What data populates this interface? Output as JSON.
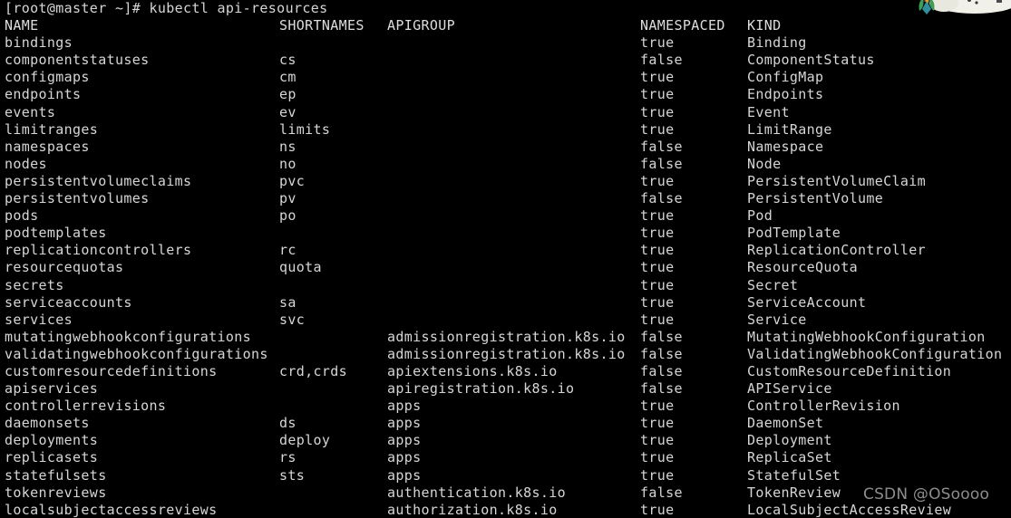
{
  "terminal": {
    "prompt_line": "[root@master ~]# kubectl api-resources",
    "prompt": "[root@master ~]#",
    "command": "kubectl api-resources",
    "foreground_color": "#d6d6d6",
    "background_color": "#000000",
    "columns": {
      "name": "NAME",
      "shortnames": "SHORTNAMES",
      "apigroup": "APIGROUP",
      "namespaced": "NAMESPACED",
      "kind": "KIND"
    },
    "rows": [
      {
        "name": "bindings",
        "shortnames": "",
        "apigroup": "",
        "namespaced": "true",
        "kind": "Binding"
      },
      {
        "name": "componentstatuses",
        "shortnames": "cs",
        "apigroup": "",
        "namespaced": "false",
        "kind": "ComponentStatus"
      },
      {
        "name": "configmaps",
        "shortnames": "cm",
        "apigroup": "",
        "namespaced": "true",
        "kind": "ConfigMap"
      },
      {
        "name": "endpoints",
        "shortnames": "ep",
        "apigroup": "",
        "namespaced": "true",
        "kind": "Endpoints"
      },
      {
        "name": "events",
        "shortnames": "ev",
        "apigroup": "",
        "namespaced": "true",
        "kind": "Event"
      },
      {
        "name": "limitranges",
        "shortnames": "limits",
        "apigroup": "",
        "namespaced": "true",
        "kind": "LimitRange"
      },
      {
        "name": "namespaces",
        "shortnames": "ns",
        "apigroup": "",
        "namespaced": "false",
        "kind": "Namespace"
      },
      {
        "name": "nodes",
        "shortnames": "no",
        "apigroup": "",
        "namespaced": "false",
        "kind": "Node"
      },
      {
        "name": "persistentvolumeclaims",
        "shortnames": "pvc",
        "apigroup": "",
        "namespaced": "true",
        "kind": "PersistentVolumeClaim"
      },
      {
        "name": "persistentvolumes",
        "shortnames": "pv",
        "apigroup": "",
        "namespaced": "false",
        "kind": "PersistentVolume"
      },
      {
        "name": "pods",
        "shortnames": "po",
        "apigroup": "",
        "namespaced": "true",
        "kind": "Pod"
      },
      {
        "name": "podtemplates",
        "shortnames": "",
        "apigroup": "",
        "namespaced": "true",
        "kind": "PodTemplate"
      },
      {
        "name": "replicationcontrollers",
        "shortnames": "rc",
        "apigroup": "",
        "namespaced": "true",
        "kind": "ReplicationController"
      },
      {
        "name": "resourcequotas",
        "shortnames": "quota",
        "apigroup": "",
        "namespaced": "true",
        "kind": "ResourceQuota"
      },
      {
        "name": "secrets",
        "shortnames": "",
        "apigroup": "",
        "namespaced": "true",
        "kind": "Secret"
      },
      {
        "name": "serviceaccounts",
        "shortnames": "sa",
        "apigroup": "",
        "namespaced": "true",
        "kind": "ServiceAccount"
      },
      {
        "name": "services",
        "shortnames": "svc",
        "apigroup": "",
        "namespaced": "true",
        "kind": "Service"
      },
      {
        "name": "mutatingwebhookconfigurations",
        "shortnames": "",
        "apigroup": "admissionregistration.k8s.io",
        "namespaced": "false",
        "kind": "MutatingWebhookConfiguration"
      },
      {
        "name": "validatingwebhookconfigurations",
        "shortnames": "",
        "apigroup": "admissionregistration.k8s.io",
        "namespaced": "false",
        "kind": "ValidatingWebhookConfiguration"
      },
      {
        "name": "customresourcedefinitions",
        "shortnames": "crd,crds",
        "apigroup": "apiextensions.k8s.io",
        "namespaced": "false",
        "kind": "CustomResourceDefinition"
      },
      {
        "name": "apiservices",
        "shortnames": "",
        "apigroup": "apiregistration.k8s.io",
        "namespaced": "false",
        "kind": "APIService"
      },
      {
        "name": "controllerrevisions",
        "shortnames": "",
        "apigroup": "apps",
        "namespaced": "true",
        "kind": "ControllerRevision"
      },
      {
        "name": "daemonsets",
        "shortnames": "ds",
        "apigroup": "apps",
        "namespaced": "true",
        "kind": "DaemonSet"
      },
      {
        "name": "deployments",
        "shortnames": "deploy",
        "apigroup": "apps",
        "namespaced": "true",
        "kind": "Deployment"
      },
      {
        "name": "replicasets",
        "shortnames": "rs",
        "apigroup": "apps",
        "namespaced": "true",
        "kind": "ReplicaSet"
      },
      {
        "name": "statefulsets",
        "shortnames": "sts",
        "apigroup": "apps",
        "namespaced": "true",
        "kind": "StatefulSet"
      },
      {
        "name": "tokenreviews",
        "shortnames": "",
        "apigroup": "authentication.k8s.io",
        "namespaced": "false",
        "kind": "TokenReview"
      },
      {
        "name": "localsubjectaccessreviews",
        "shortnames": "",
        "apigroup": "authorization.k8s.io",
        "namespaced": "true",
        "kind": "LocalSubjectAccessReview"
      }
    ]
  },
  "watermark": {
    "text": "CSDN @OSoooo",
    "color": "#8d8d8d"
  },
  "corner_sticker": {
    "label": "cartoon-sticker",
    "colors": {
      "cloud": "#f2f1e9",
      "plant_green": "#3f9e55",
      "plant_teal": "#2f8f9e",
      "flame_orange": "#f0a028",
      "dark": "#3a3a3a"
    }
  }
}
